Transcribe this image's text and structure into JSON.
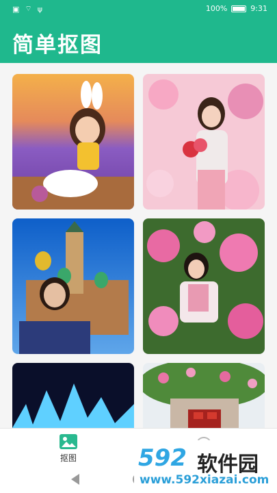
{
  "status_bar": {
    "battery": "100%",
    "time": "9:31",
    "icons": [
      "notification-icon",
      "wifi-icon",
      "usb-icon"
    ]
  },
  "appbar": {
    "title": "简单抠图"
  },
  "cards": [
    {
      "name": "girl-bunny-ears-lavender-field"
    },
    {
      "name": "woman-roses-hearts"
    },
    {
      "name": "woman-church-onion-domes"
    },
    {
      "name": "woman-pink-lilies"
    },
    {
      "name": "ice-castle-night"
    },
    {
      "name": "flower-arch-gate"
    }
  ],
  "bottom_nav": {
    "items": [
      {
        "label": "抠图",
        "icon": "image-icon"
      }
    ]
  },
  "watermark": {
    "number": "592",
    "text": "软件园",
    "url": "www.592xiazai.com"
  },
  "colors": {
    "accent": "#1fb88d"
  }
}
